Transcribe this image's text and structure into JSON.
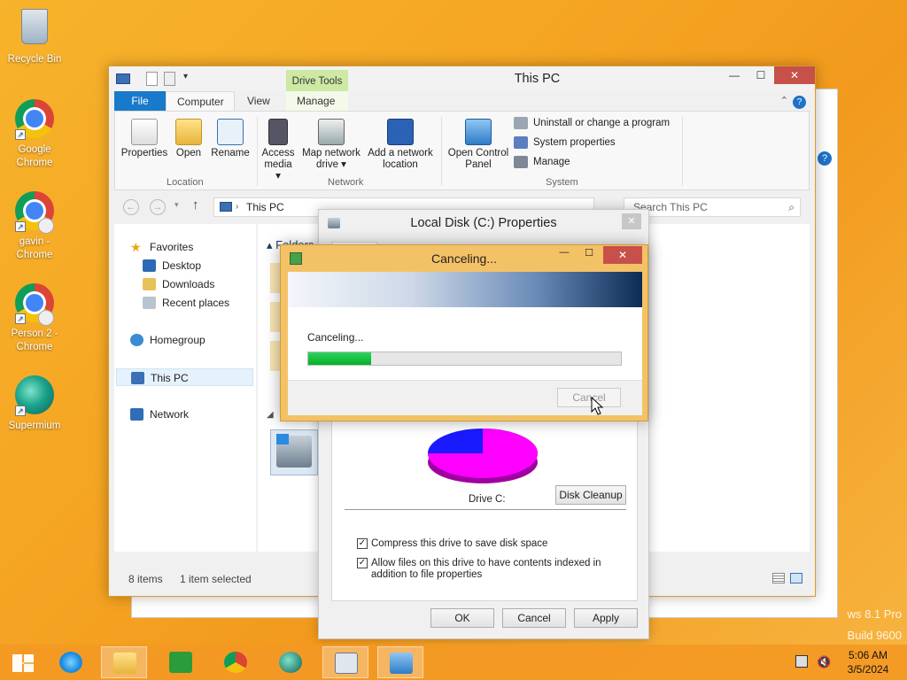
{
  "desktop": {
    "icons": [
      {
        "label": "Recycle Bin"
      },
      {
        "label": "Google Chrome"
      },
      {
        "label": "gavin - Chrome"
      },
      {
        "label": "Person 2 - Chrome"
      },
      {
        "label": "Supermium"
      }
    ],
    "watermark": {
      "line1": "ws 8.1 Pro",
      "line2": "Build 9600"
    }
  },
  "explorer": {
    "title": "This PC",
    "context_tab": "Drive Tools",
    "tabs": [
      "File",
      "Computer",
      "View",
      "Manage"
    ],
    "ribbon": {
      "location": {
        "label": "Location",
        "buttons": [
          "Properties",
          "Open",
          "Rename"
        ]
      },
      "network": {
        "label": "Network",
        "buttons": [
          "Access media ▾",
          "Map network drive ▾",
          "Add a network location"
        ]
      },
      "system": {
        "label": "System",
        "open_control_panel": "Open Control Panel",
        "commands": [
          "Uninstall or change a program",
          "System properties",
          "Manage"
        ]
      }
    },
    "address": "This PC",
    "search_placeholder": "Search This PC",
    "nav": {
      "favorites": "Favorites",
      "items": [
        "Desktop",
        "Downloads",
        "Recent places"
      ],
      "homegroup": "Homegroup",
      "this_pc": "This PC",
      "network": "Network"
    },
    "content": {
      "folders_header": "Folders"
    },
    "status": {
      "items": "8 items",
      "selected": "1 item selected"
    }
  },
  "properties": {
    "title": "Local Disk (C:) Properties",
    "drive_label": "Drive C:",
    "disk_cleanup": "Disk Cleanup",
    "compress": "Compress this drive to save disk space",
    "index": "Allow files on this drive to have contents indexed in addition to file properties",
    "buttons": {
      "ok": "OK",
      "cancel": "Cancel",
      "apply": "Apply"
    },
    "pie": {
      "used_color": "#ff00ff",
      "free_color": "#1a1aff",
      "used_fraction": 0.75
    }
  },
  "canceling": {
    "title": "Canceling...",
    "message": "Canceling...",
    "progress": 0.2,
    "cancel_button": "Cancel"
  },
  "taskbar": {
    "clock_time": "5:06 AM",
    "clock_date": "3/5/2024"
  }
}
